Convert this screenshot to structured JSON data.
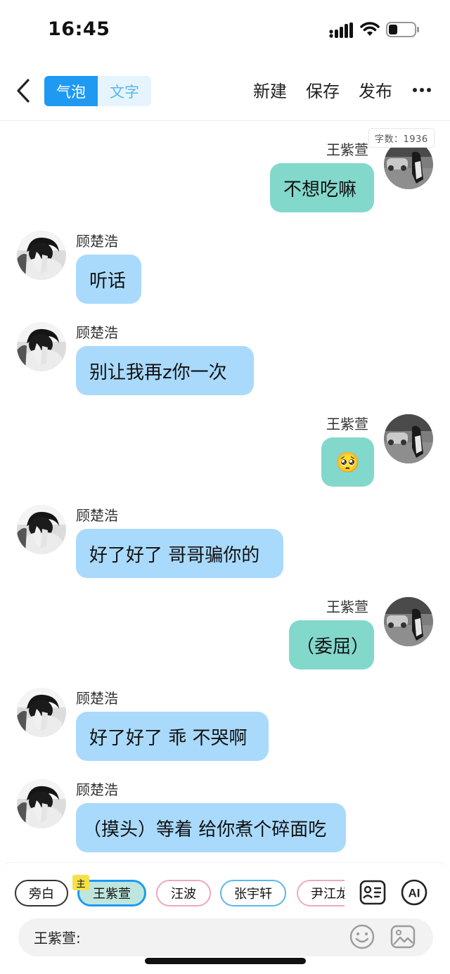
{
  "status_bar": {
    "time": "16:45"
  },
  "nav": {
    "tabs": [
      {
        "label": "气泡",
        "active": true
      },
      {
        "label": "文字",
        "active": false
      }
    ],
    "actions": {
      "new": "新建",
      "save": "保存",
      "publish": "发布"
    }
  },
  "word_count": "字数：1936",
  "colors": {
    "accent": "#1e9af2",
    "left_bubble": "#a9dafc",
    "right_bubble": "#83d8cc"
  },
  "messages": [
    {
      "sender": "王紫萱",
      "text": "不想吃嘛",
      "side": "right"
    },
    {
      "sender": "顾楚浩",
      "text": "听话",
      "side": "left"
    },
    {
      "sender": "顾楚浩",
      "text": "别让我再z你一次",
      "side": "left"
    },
    {
      "sender": "王紫萱",
      "text": "🥺",
      "side": "right"
    },
    {
      "sender": "顾楚浩",
      "text": "好了好了 哥哥骗你的",
      "side": "left"
    },
    {
      "sender": "王紫萱",
      "text": "（委屈）",
      "side": "right"
    },
    {
      "sender": "顾楚浩",
      "text": "好了好了 乖 不哭啊",
      "side": "left"
    },
    {
      "sender": "顾楚浩",
      "text": "（摸头）等着 给你煮个碎面吃",
      "side": "left"
    }
  ],
  "roles": [
    {
      "label": "旁白"
    },
    {
      "label": "王紫萱",
      "selected": true,
      "badge": "主"
    },
    {
      "label": "汪波"
    },
    {
      "label": "张宇轩"
    },
    {
      "label": "尹江龙"
    }
  ],
  "input": {
    "prefix": "王紫萱:"
  }
}
